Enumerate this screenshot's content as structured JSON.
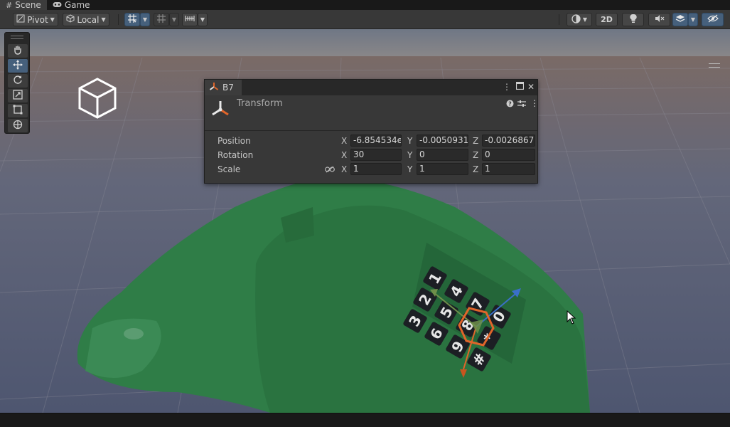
{
  "tabs": [
    {
      "label": "Scene",
      "icon": "hash-icon"
    },
    {
      "label": "Game",
      "icon": "gamepad-icon"
    }
  ],
  "toolbar": {
    "pivot_label": "Pivot",
    "local_label": "Local",
    "mode_2d_label": "2D"
  },
  "inspector": {
    "tab_title": "B7",
    "component_title": "Transform",
    "rows": [
      {
        "label": "Position",
        "x": "-6.854534e",
        "y": "-0.0050931",
        "z": "-0.0026867"
      },
      {
        "label": "Rotation",
        "x": "30",
        "y": "0",
        "z": "0"
      },
      {
        "label": "Scale",
        "x": "1",
        "y": "1",
        "z": "1"
      }
    ],
    "axis_labels": {
      "x": "X",
      "y": "Y",
      "z": "Z"
    }
  },
  "keypad": [
    "1",
    "2",
    "3",
    "4",
    "5",
    "6",
    "7",
    "8",
    "9",
    "0",
    "*",
    "#"
  ],
  "colors": {
    "selection_blue": "#46607c",
    "phone_green": "#2e7a45",
    "handle_orange": "#e0652a",
    "handle_blue": "#3a6fc8"
  }
}
